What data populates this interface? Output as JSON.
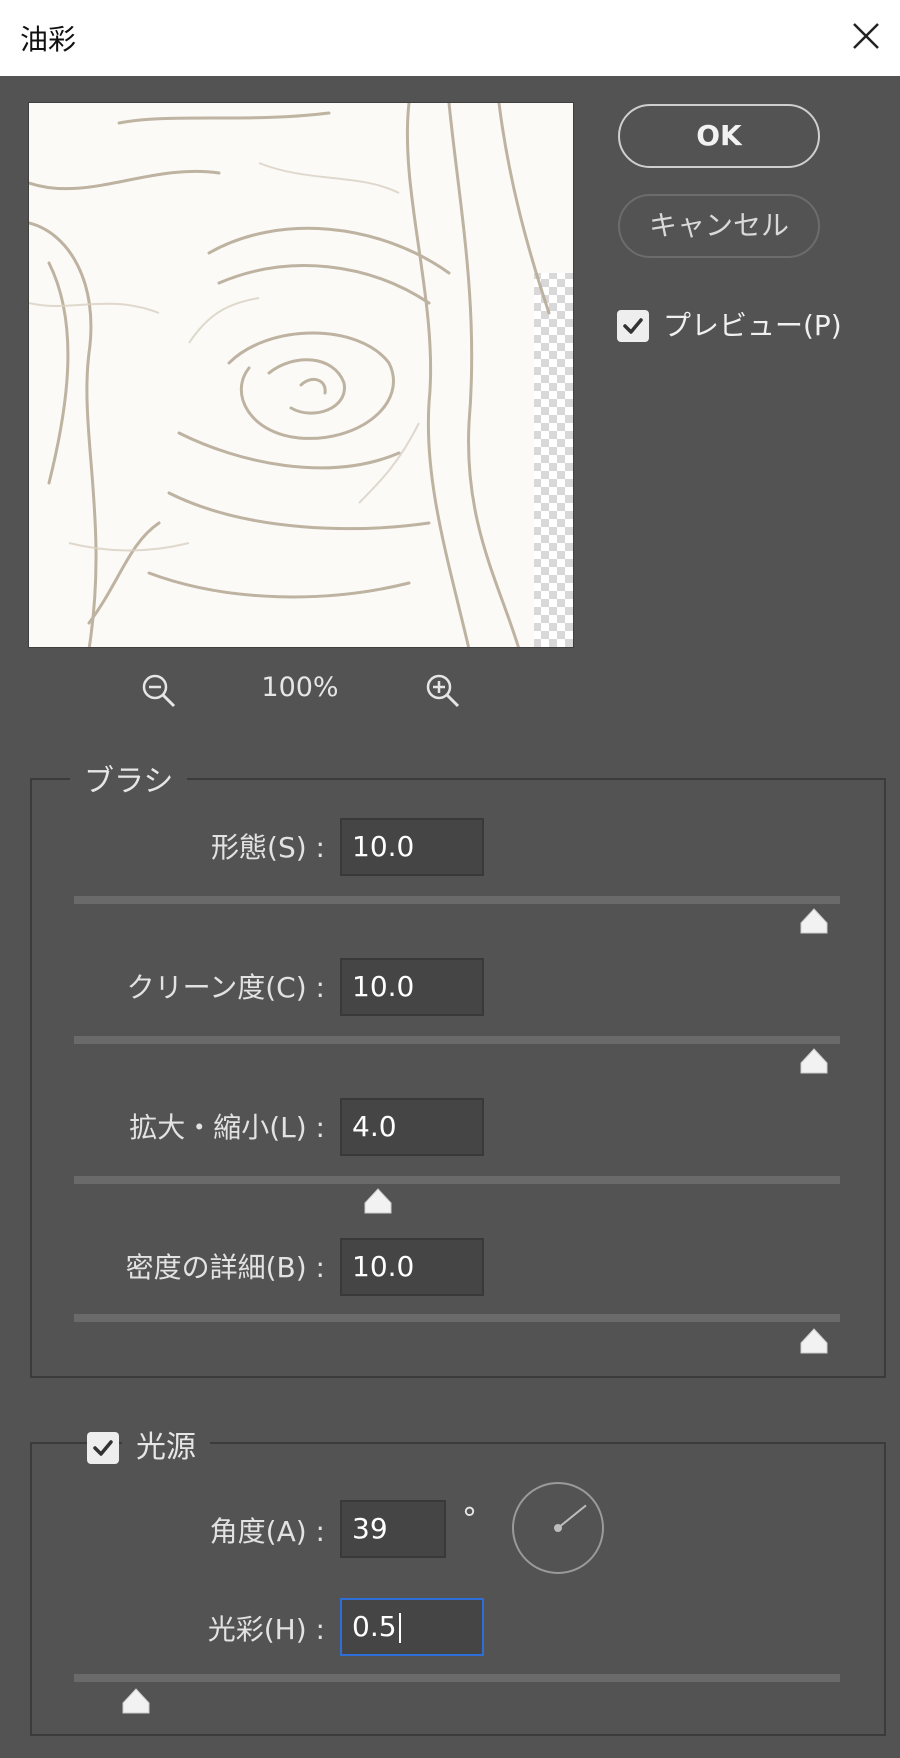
{
  "window": {
    "title": "油彩"
  },
  "preview": {
    "zoom_level": "100%"
  },
  "buttons": {
    "ok": "OK",
    "cancel": "キャンセル"
  },
  "preview_toggle": {
    "label": "プレビュー(P)",
    "checked": true
  },
  "brush": {
    "legend": "ブラシ",
    "fields": [
      {
        "label": "形態(S) :",
        "value": "10.0",
        "slider": 1.0
      },
      {
        "label": "クリーン度(C) :",
        "value": "10.0",
        "slider": 1.0
      },
      {
        "label": "拡大・縮小(L) :",
        "value": "4.0",
        "slider": 0.39
      },
      {
        "label": "密度の詳細(B) :",
        "value": "10.0",
        "slider": 1.0
      }
    ]
  },
  "lighting": {
    "legend": "光源",
    "checked": true,
    "angle": {
      "label": "角度(A) :",
      "value": "39",
      "unit": "°"
    },
    "shine": {
      "label": "光彩(H) :",
      "value": "0.5",
      "slider": 0.05
    }
  },
  "icons": {
    "close": "close-icon",
    "zoom_out": "zoom-out-icon",
    "zoom_in": "zoom-in-icon",
    "check": "check-icon",
    "angle_dial": "angle-dial-icon",
    "slider_thumb": "slider-thumb-icon"
  },
  "colors": {
    "background": "#535353",
    "title_bar": "#ffffff",
    "focus": "#2d6fd6"
  }
}
